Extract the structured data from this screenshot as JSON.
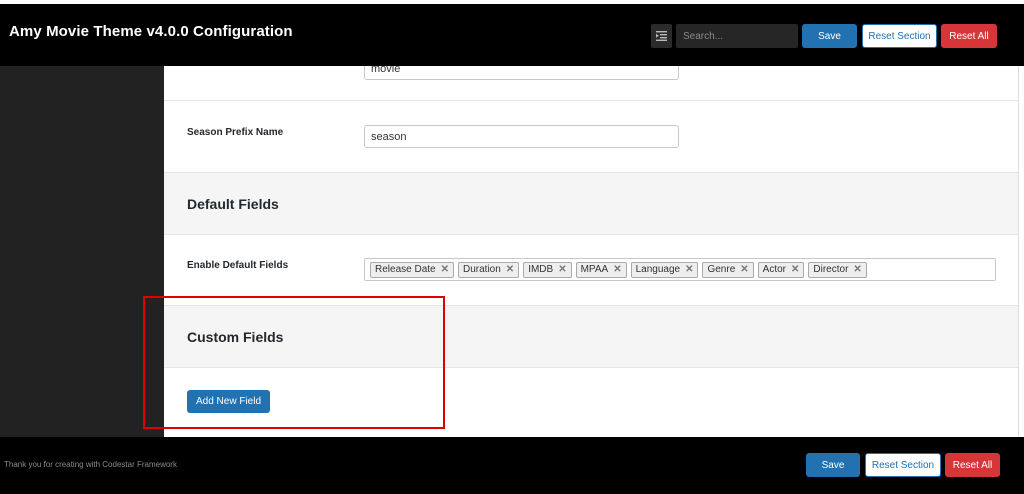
{
  "header": {
    "title": "Amy Movie Theme v4.0.0 Configuration",
    "search_placeholder": "Search...",
    "save_label": "Save",
    "reset_section_label": "Reset Section",
    "reset_all_label": "Reset All"
  },
  "fields": {
    "movie_prefix_value": "movie",
    "season_prefix_label": "Season Prefix Name",
    "season_prefix_value": "season"
  },
  "default_fields": {
    "heading": "Default Fields",
    "enable_label": "Enable Default Fields",
    "tags": [
      "Release Date",
      "Duration",
      "IMDB",
      "MPAA",
      "Language",
      "Genre",
      "Actor",
      "Director"
    ],
    "remove_glyph": "✕"
  },
  "custom_fields": {
    "heading": "Custom Fields",
    "add_button_label": "Add New Field"
  },
  "footer": {
    "text": "Thank you for creating with Codestar Framework",
    "save_label": "Save",
    "reset_section_label": "Reset Section",
    "reset_all_label": "Reset All"
  },
  "colors": {
    "primary": "#2271b1",
    "danger": "#d63638",
    "highlight": "#e00000"
  },
  "icons": {
    "expand": "expand-all-icon",
    "remove": "close-icon"
  }
}
